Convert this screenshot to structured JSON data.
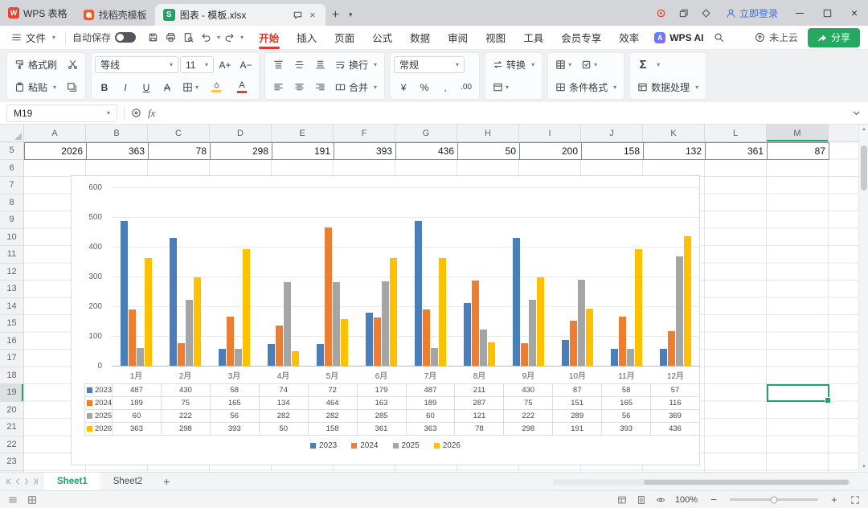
{
  "theme": {
    "selection-green": "#21a366",
    "active-red": "#d83b2e",
    "share-green": "#25a961",
    "login-blue": "#3f6ff5"
  },
  "titlebar": {
    "app_button": "WPS 表格",
    "template_tab": "找稻壳模板",
    "doc_tab": "图表 - 模板.xlsx",
    "login": "立即登录"
  },
  "menubar": {
    "file": "文件",
    "autosave": "自动保存",
    "tabs": [
      "开始",
      "插入",
      "页面",
      "公式",
      "数据",
      "审阅",
      "视图",
      "工具",
      "会员专享",
      "效率"
    ],
    "active_tab": "开始",
    "wps_ai": "WPS AI",
    "cloud_status": "未上云",
    "share": "分享"
  },
  "toolbar": {
    "format_painter": "格式刷",
    "paste": "粘贴",
    "font_name": "等线",
    "font_size": "11",
    "wrap": "换行",
    "merge": "合并",
    "number_format": "常规",
    "convert": "转换",
    "conditional_format": "条件格式",
    "data_process": "数据处理"
  },
  "formula_bar": {
    "cell_ref": "M19",
    "fx_label": "fx"
  },
  "grid": {
    "columns": [
      "A",
      "B",
      "C",
      "D",
      "E",
      "F",
      "G",
      "H",
      "I",
      "J",
      "K",
      "L",
      "M"
    ],
    "selected_column": "M",
    "rows": [
      "5",
      "6",
      "7",
      "8",
      "9",
      "10",
      "11",
      "12",
      "13",
      "14",
      "15",
      "16",
      "17",
      "18",
      "19",
      "20",
      "21",
      "22",
      "23"
    ],
    "selected_row": "19",
    "data_row": {
      "row": "5",
      "values": [
        "2026",
        "363",
        "78",
        "298",
        "191",
        "393",
        "436",
        "50",
        "200",
        "158",
        "132",
        "361",
        "87"
      ]
    },
    "selected_cell": "M19"
  },
  "chart_data": {
    "type": "bar",
    "categories": [
      "1月",
      "2月",
      "3月",
      "4月",
      "5月",
      "6月",
      "7月",
      "8月",
      "9月",
      "10月",
      "11月",
      "12月"
    ],
    "series": [
      {
        "name": "2023",
        "color": "#4a7ebb",
        "values": [
          487,
          430,
          58,
          74,
          72,
          179,
          487,
          211,
          430,
          87,
          58,
          57
        ]
      },
      {
        "name": "2024",
        "color": "#ed7d31",
        "values": [
          189,
          75,
          165,
          134,
          464,
          163,
          189,
          287,
          75,
          151,
          165,
          116
        ]
      },
      {
        "name": "2025",
        "color": "#a5a5a5",
        "values": [
          60,
          222,
          56,
          282,
          282,
          285,
          60,
          121,
          222,
          289,
          56,
          369
        ]
      },
      {
        "name": "2026",
        "color": "#ffc000",
        "values": [
          363,
          298,
          393,
          50,
          158,
          361,
          363,
          78,
          298,
          191,
          393,
          436
        ]
      }
    ],
    "ylim": [
      0,
      600
    ],
    "ytick_interval": 100,
    "grid": true,
    "legend_position": "bottom",
    "data_table": true
  },
  "sheet_bar": {
    "tabs": [
      "Sheet1",
      "Sheet2"
    ],
    "active_tab": "Sheet1"
  },
  "status_bar": {
    "zoom": "100%"
  }
}
